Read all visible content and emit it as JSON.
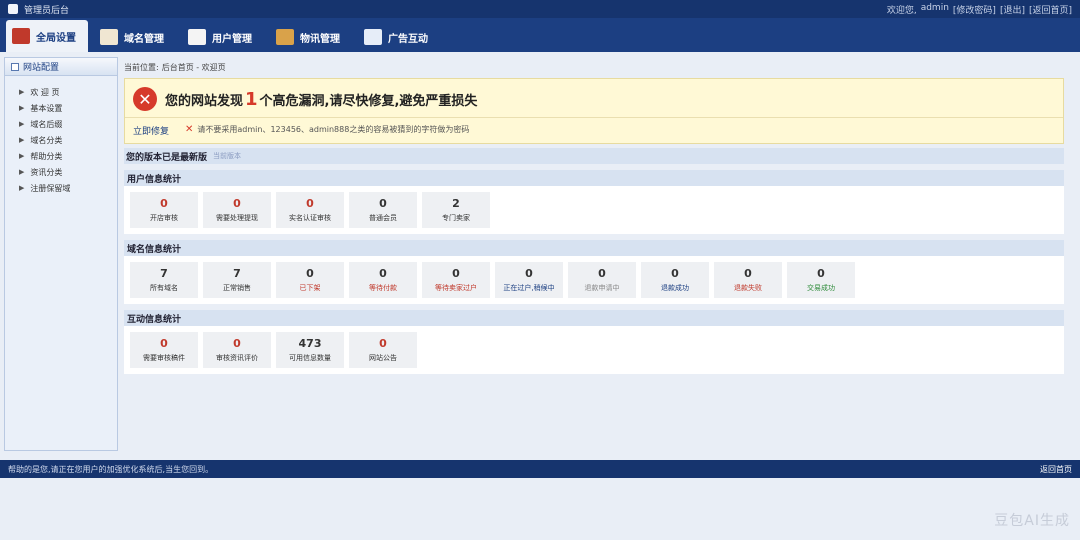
{
  "topbar": {
    "title": "管理员后台",
    "welcome": "欢迎您,",
    "user": "admin",
    "change_password": "[修改密码]",
    "logout": "[退出]",
    "back_home": "[返回首页]"
  },
  "nav": {
    "tabs": [
      {
        "label": "全局设置",
        "icon": "settings-icon",
        "active": true
      },
      {
        "label": "域名管理",
        "icon": "domain-icon"
      },
      {
        "label": "用户管理",
        "icon": "users-icon"
      },
      {
        "label": "物讯管理",
        "icon": "box-icon"
      },
      {
        "label": "广告互动",
        "icon": "ad-icon"
      }
    ]
  },
  "sidebar": {
    "header": "网站配置",
    "items": [
      "欢 迎 页",
      "基本设置",
      "域名后缀",
      "域名分类",
      "帮助分类",
      "资讯分类",
      "注册保留域"
    ]
  },
  "breadcrumb": {
    "label": "当前位置:",
    "path": "后台首页 - 欢迎页"
  },
  "alert": {
    "title_pre": "您的网站发现",
    "count": "1",
    "title_post": "个高危漏洞,请尽快修复,避免严重损失",
    "fix_link": "立即修复",
    "tip": "请不要采用admin、123456、admin888之类的容易被猜到的字符做为密码"
  },
  "version": {
    "text": "您的版本已是最新版",
    "small": "当前版本"
  },
  "sections": [
    {
      "title": "用户信息统计",
      "cards": [
        {
          "value": "0",
          "label": "开店审核",
          "color": "#c0392b"
        },
        {
          "value": "0",
          "label": "需要处理提现",
          "color": "#c0392b"
        },
        {
          "value": "0",
          "label": "实名认证审核",
          "color": "#c0392b"
        },
        {
          "value": "0",
          "label": "普通会员",
          "color": "#222"
        },
        {
          "value": "2",
          "label": "专门卖家",
          "color": "#222"
        }
      ]
    },
    {
      "title": "域名信息统计",
      "cards": [
        {
          "value": "7",
          "label": "所有域名",
          "color": "#222"
        },
        {
          "value": "7",
          "label": "正常销售",
          "color": "#222"
        },
        {
          "value": "0",
          "label": "已下架",
          "color": "#c0392b"
        },
        {
          "value": "0",
          "label": "等待付款",
          "color": "#c0392b"
        },
        {
          "value": "0",
          "label": "等待卖家过户",
          "color": "#c0392b"
        },
        {
          "value": "0",
          "label": "正在过户,稍候中",
          "color": "#1c3f82"
        },
        {
          "value": "0",
          "label": "退款申请中",
          "color": "#777"
        },
        {
          "value": "0",
          "label": "退款成功",
          "color": "#1c3f82"
        },
        {
          "value": "0",
          "label": "退款失败",
          "color": "#c0392b"
        },
        {
          "value": "0",
          "label": "交易成功",
          "color": "#2e8b3a"
        }
      ]
    },
    {
      "title": "互动信息统计",
      "cards": [
        {
          "value": "0",
          "label": "需要审核稿件",
          "color": "#c0392b"
        },
        {
          "value": "0",
          "label": "审核资讯评价",
          "color": "#c0392b"
        },
        {
          "value": "473",
          "label": "可用信息数量",
          "color": "#222"
        },
        {
          "value": "0",
          "label": "网站公告",
          "color": "#c0392b"
        }
      ]
    }
  ],
  "footer": {
    "text": "帮助的是您,请正在您用户的加强优化系统后,当生您回到。",
    "back_top": "返回首页"
  },
  "watermark": "豆包AI生成"
}
